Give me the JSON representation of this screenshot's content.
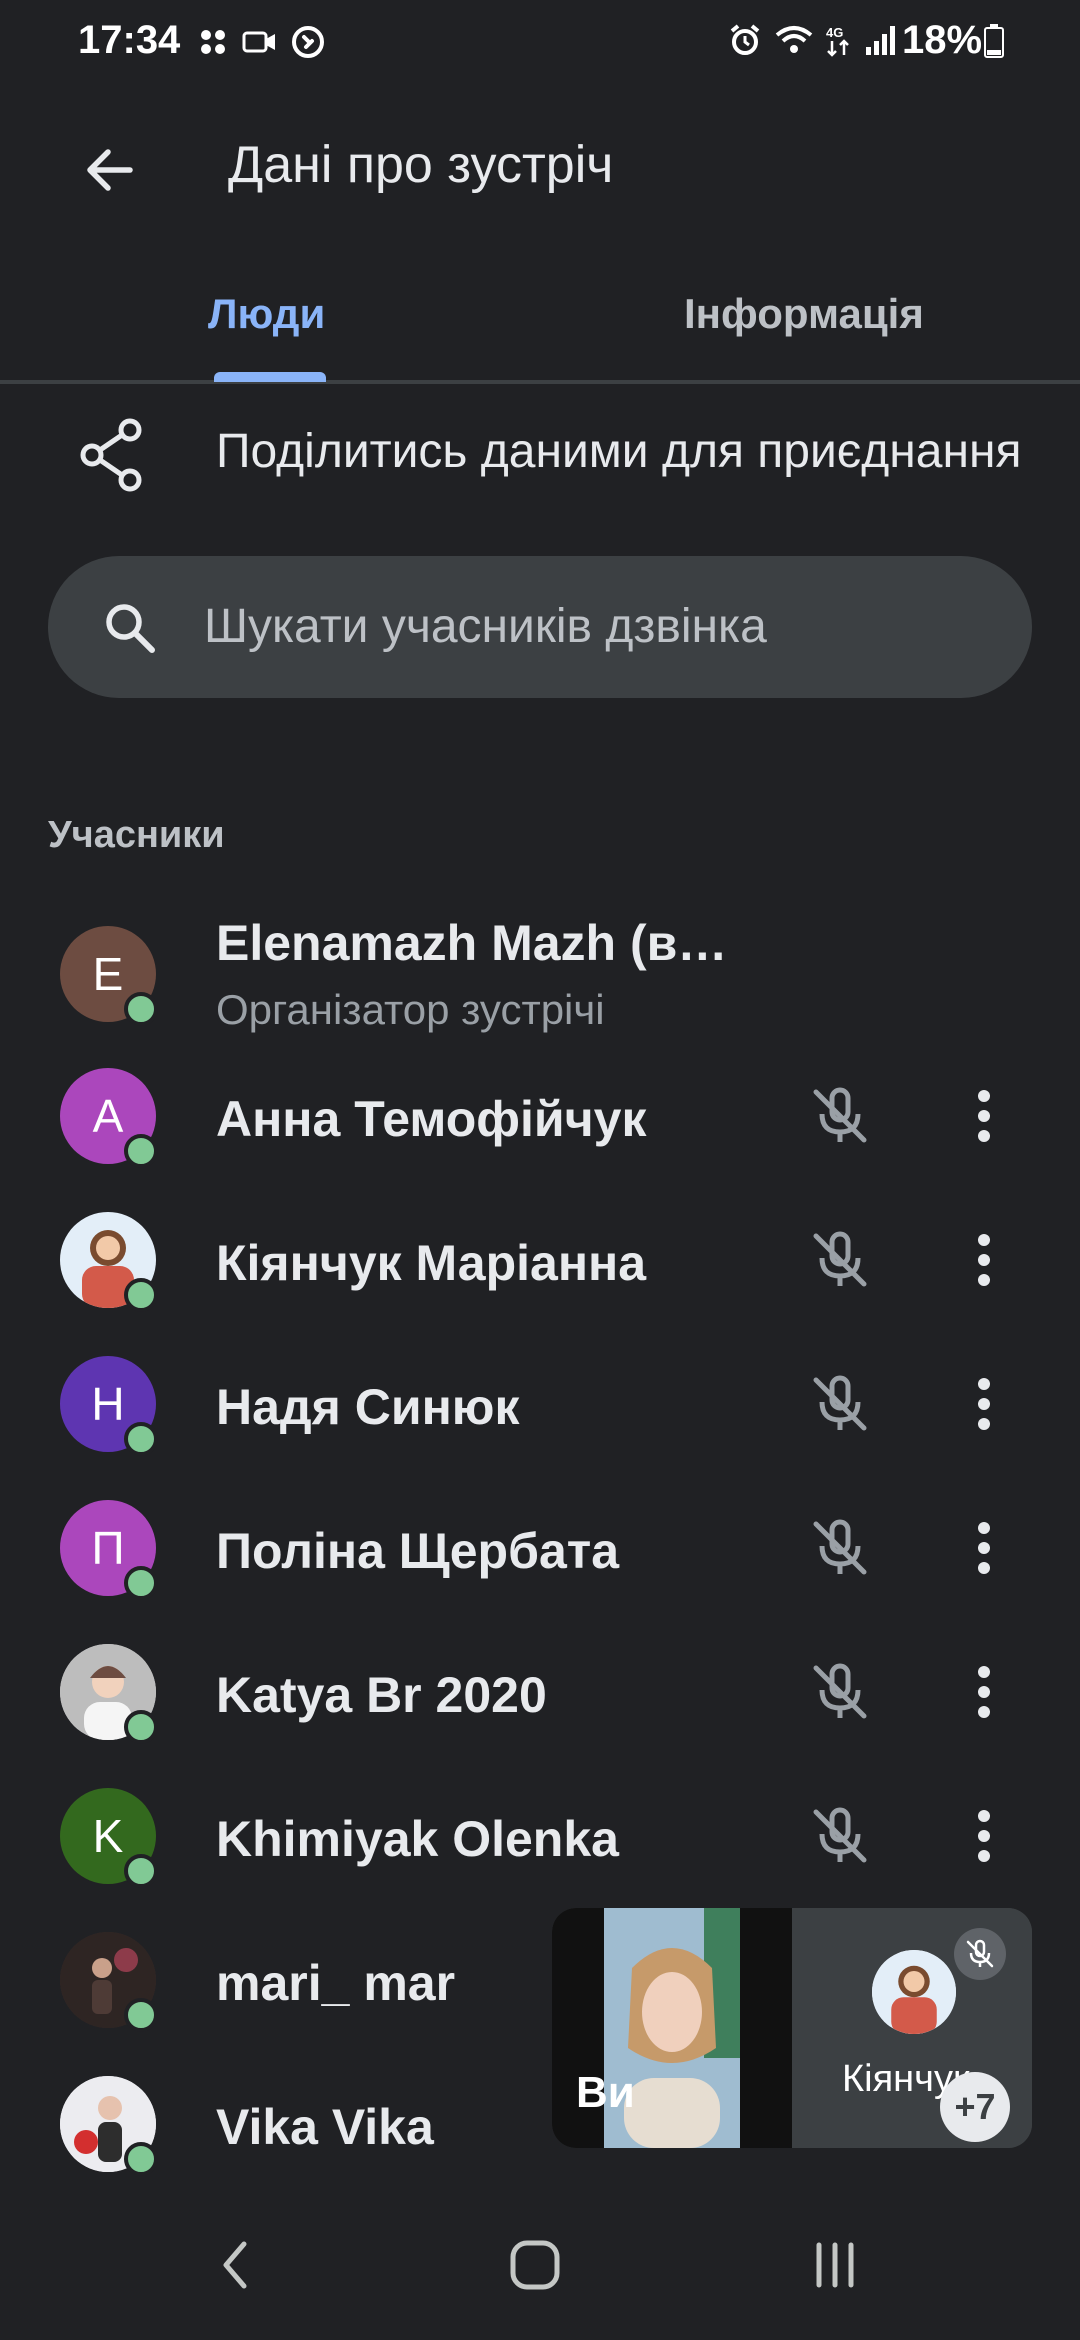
{
  "status_bar": {
    "time": "17:34",
    "battery": "18%",
    "left_icons": [
      "grid-icon",
      "camera-icon",
      "shazam-icon"
    ],
    "right_icons": [
      "alarm-icon",
      "wifi-icon",
      "4g-icon",
      "signal-icon"
    ]
  },
  "header": {
    "title": "Дані про зустріч"
  },
  "tabs": [
    {
      "label": "Люди",
      "active": true
    },
    {
      "label": "Інформація",
      "active": false
    }
  ],
  "share": {
    "label": "Поділитись даними для приєднання"
  },
  "search": {
    "placeholder": "Шукати учасників дзвінка"
  },
  "section": {
    "label": "Учасники"
  },
  "participants": [
    {
      "name": "Elenamazh Mazh (в…",
      "role": "Організатор зустрічі",
      "initial": "E",
      "color": "#6d4c41"
    },
    {
      "name": "Анна Темофійчук",
      "initial": "А",
      "color": "#ab47bc",
      "muted": true
    },
    {
      "name": "Кіянчук Маріанна",
      "initial": "",
      "color": "#e3eef8",
      "muted": true
    },
    {
      "name": "Надя Синюк",
      "initial": "Н",
      "color": "#5e35b1",
      "muted": true
    },
    {
      "name": "Поліна Щербата",
      "initial": "П",
      "color": "#ab47bc",
      "muted": true
    },
    {
      "name": "Katya Br 2020",
      "initial": "",
      "color": "#cfcfcf",
      "muted": true
    },
    {
      "name": "Khimiyak Olenka",
      "initial": "K",
      "color": "#33691e",
      "muted": true
    },
    {
      "name": "mari_ mar",
      "initial": "",
      "color": "#3a2f2c",
      "muted": true
    },
    {
      "name": "Vika Vika",
      "initial": "",
      "color": "#e9e9ee",
      "muted": true
    }
  ],
  "pip": {
    "self_label": "Ви",
    "other_label": "Кіянчук",
    "more_count": "+7"
  },
  "colors": {
    "accent": "#8ab4f8",
    "online": "#81c995",
    "background": "#202124"
  }
}
